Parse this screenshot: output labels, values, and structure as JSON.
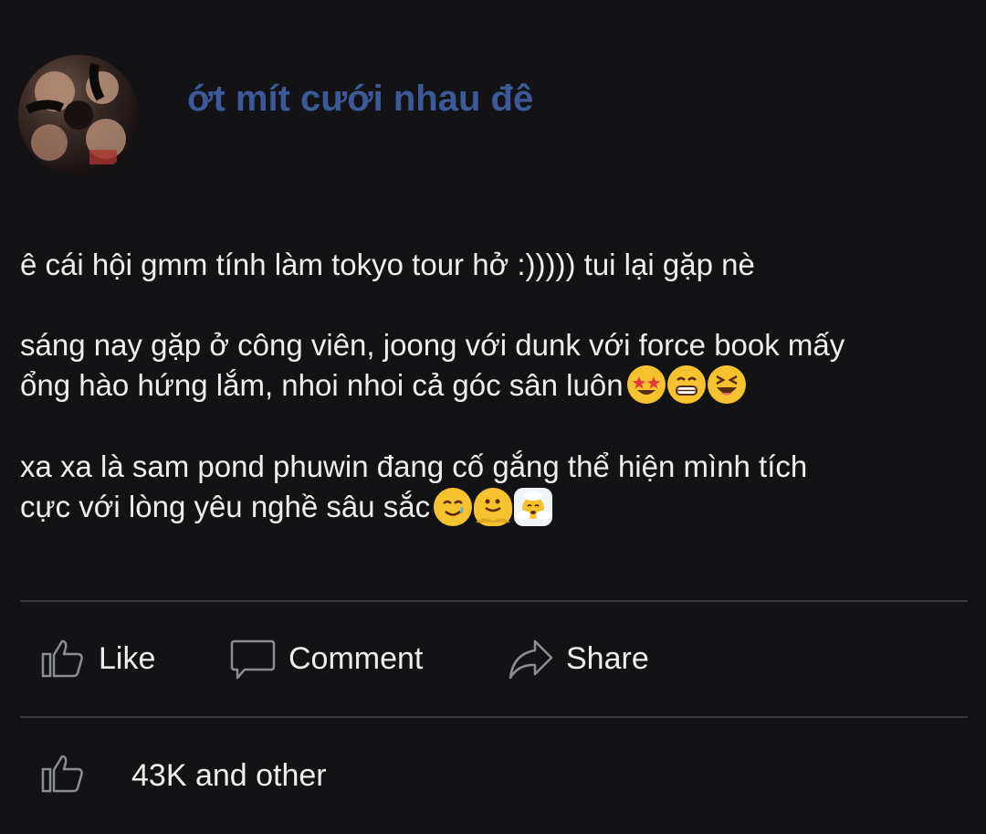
{
  "post": {
    "author": "ớt mít cưới nhau đê",
    "paragraphs": [
      {
        "text": "ê cái hội gmm tính làm tokyo tour hở :))))) tui lại gặp nè",
        "emojis": []
      },
      {
        "text": "sáng nay gặp ở công viên, joong với dunk với force book mấy\nổng hào hứng lắm, nhoi nhoi cả góc sân luôn",
        "emojis": [
          "star-struck-emoji",
          "grinning-emoji",
          "laughing-emoji"
        ]
      },
      {
        "text": "xa xa là sam pond phuwin đang cố gắng thể hiện mình tích\ncực với lòng yêu nghề sâu sắc",
        "emojis": [
          "smiling-tear-emoji",
          "melting-face-emoji",
          "face-in-clouds-emoji"
        ]
      }
    ]
  },
  "actions": {
    "like_label": "Like",
    "comment_label": "Comment",
    "share_label": "Share"
  },
  "reactions": {
    "count_text": "43K and other"
  },
  "colors": {
    "background": "#131315",
    "author_name": "#3c5a99",
    "text": "#eeeeee",
    "divider": "#3a3a3d",
    "icon_stroke": "#8a8d93"
  }
}
